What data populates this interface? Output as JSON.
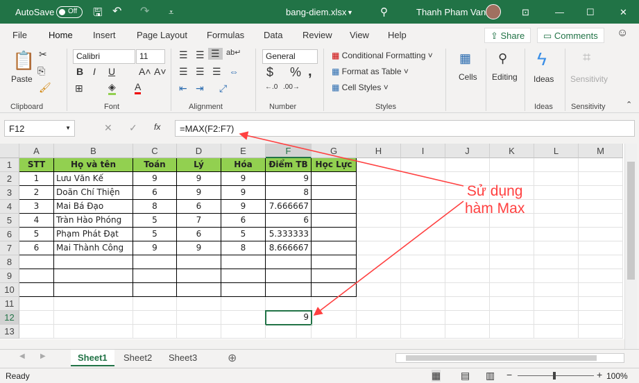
{
  "titlebar": {
    "autosave": "AutoSave",
    "autosave_state": "Off",
    "filename": "bang-diem.xlsx",
    "user": "Thanh Pham Van"
  },
  "tabs": [
    "File",
    "Home",
    "Insert",
    "Page Layout",
    "Formulas",
    "Data",
    "Review",
    "View",
    "Help"
  ],
  "share": "Share",
  "comments": "Comments",
  "ribbon": {
    "paste": "Paste",
    "font_name": "Calibri",
    "font_size": "11",
    "number_format": "General",
    "conditional": "Conditional Formatting",
    "format_table": "Format as Table",
    "cell_styles": "Cell Styles",
    "cells": "Cells",
    "editing": "Editing",
    "ideas": "Ideas",
    "sensitivity": "Sensitivity",
    "groups": [
      "Clipboard",
      "Font",
      "Alignment",
      "Number",
      "Styles",
      "Ideas",
      "Sensitivity"
    ]
  },
  "formula_bar": {
    "name_box": "F12",
    "formula": "=MAX(F2:F7)"
  },
  "columns": [
    "A",
    "B",
    "C",
    "D",
    "E",
    "F",
    "G",
    "H",
    "I",
    "J",
    "K",
    "L",
    "M"
  ],
  "rows": [
    "1",
    "2",
    "3",
    "4",
    "5",
    "6",
    "7",
    "8",
    "9",
    "10",
    "11",
    "12",
    "13"
  ],
  "table": {
    "headers": [
      "STT",
      "Họ và tên",
      "Toán",
      "Lý",
      "Hóa",
      "Điểm TB",
      "Học Lực"
    ],
    "data": [
      [
        "1",
        "Lưu Văn Kế",
        "9",
        "9",
        "9",
        "9",
        ""
      ],
      [
        "2",
        "Doãn Chí Thiện",
        "6",
        "9",
        "9",
        "8",
        ""
      ],
      [
        "3",
        "Mai Bá Đạo",
        "8",
        "6",
        "9",
        "7.666667",
        ""
      ],
      [
        "4",
        "Tràn Hào Phóng",
        "5",
        "7",
        "6",
        "6",
        ""
      ],
      [
        "5",
        "Phạm Phát Đạt",
        "5",
        "6",
        "5",
        "5.333333",
        ""
      ],
      [
        "6",
        "Mai Thành Công",
        "9",
        "9",
        "8",
        "8.666667",
        ""
      ]
    ]
  },
  "result_cell": {
    "ref": "F12",
    "value": "9"
  },
  "annotation": {
    "line1": "Sử dụng",
    "line2": "hàm Max",
    "color": "#ff4040"
  },
  "sheets": [
    "Sheet1",
    "Sheet2",
    "Sheet3"
  ],
  "status": {
    "ready": "Ready",
    "zoom": "100%"
  }
}
